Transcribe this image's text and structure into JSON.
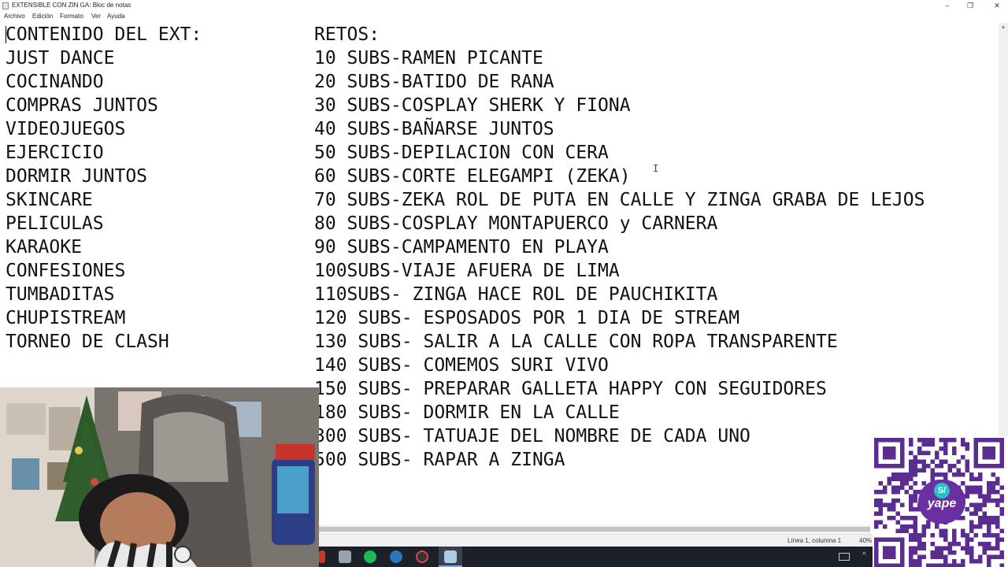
{
  "window": {
    "title": "EXTENSIBLE CON ZIN GA: Bloc de notas",
    "minimize_icon": "minimize-icon",
    "restore_icon": "restore-icon",
    "close_icon": "close-icon"
  },
  "menu": [
    "Archivo",
    "Edición",
    "Formato",
    "Ver",
    "Ayuda"
  ],
  "content": {
    "left_header": "CONTENIDO DEL EXT:",
    "right_header": "RETOS:",
    "left": [
      "JUST DANCE",
      "COCINANDO",
      "COMPRAS JUNTOS",
      "VIDEOJUEGOS",
      "EJERCICIO",
      "DORMIR JUNTOS",
      "SKINCARE",
      "PELICULAS",
      "KARAOKE",
      "CONFESIONES",
      "TUMBADITAS",
      "CHUPISTREAM",
      "TORNEO DE CLASH"
    ],
    "right": [
      "10 SUBS-RAMEN PICANTE",
      "20 SUBS-BATIDO DE RANA",
      "30 SUBS-COSPLAY SHERK Y FIONA",
      "40 SUBS-BAÑARSE JUNTOS",
      "50 SUBS-DEPILACION CON CERA",
      "60 SUBS-CORTE ELEGAMPI (ZEKA)",
      "70 SUBS-ZEKA ROL DE PUTA EN CALLE Y ZINGA GRABA DE LEJOS",
      "80 SUBS-COSPLAY MONTAPUERCO y CARNERA",
      "90 SUBS-CAMPAMENTO EN PLAYA",
      "100SUBS-VIAJE AFUERA DE LIMA",
      "110SUBS- ZINGA HACE ROL DE PAUCHIKITA",
      "120 SUBS- ESPOSADOS POR 1 DIA DE STREAM",
      "130 SUBS- SALIR A LA CALLE CON ROPA TRANSPARENTE",
      "140 SUBS- COMEMOS SURI VIVO",
      "150 SUBS- PREPARAR GALLETA HAPPY CON SEGUIDORES",
      "180 SUBS- DORMIR EN LA CALLE",
      "300 SUBS- TATUAJE DEL NOMBRE DE CADA UNO",
      "500 SUBS- RAPAR A ZINGA"
    ]
  },
  "status": {
    "position": "Línea 1, columna 1",
    "zoom": "40%"
  },
  "overlay": {
    "qr_badge_symbol": "S/",
    "qr_badge_text": "yape",
    "webcam_icon": "webcam-feed"
  },
  "taskbar_icons": [
    "app-icon-red",
    "folder-icon",
    "spotify-icon",
    "steam-icon",
    "browser-icon",
    "notepad-icon"
  ],
  "tray_icons": [
    "keyboard-icon",
    "chevron-up-icon"
  ],
  "colors": {
    "qr_purple": "#5c2d91",
    "spotify_green": "#1db954"
  }
}
